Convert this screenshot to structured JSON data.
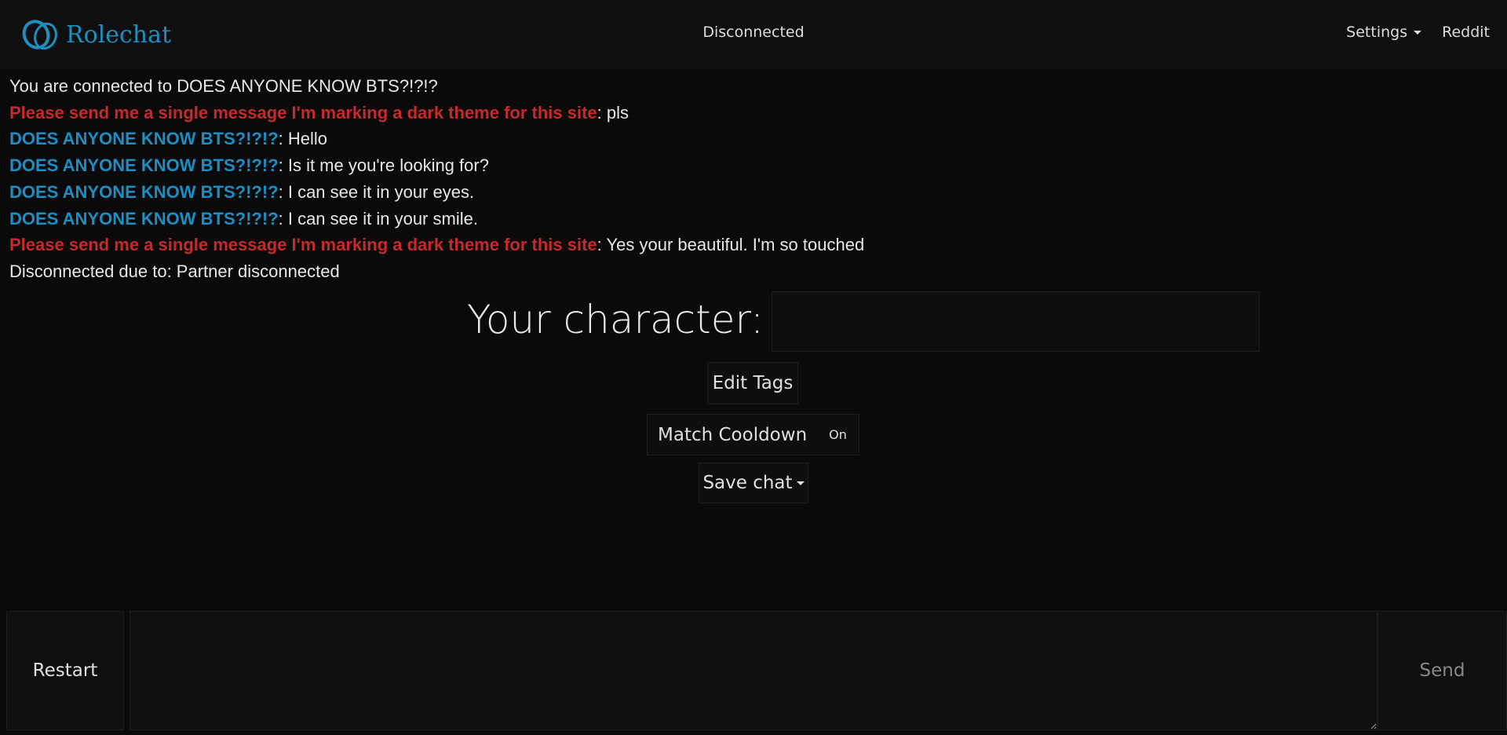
{
  "navbar": {
    "brand": "Rolechat",
    "status": "Disconnected",
    "settings_label": "Settings",
    "reddit_label": "Reddit"
  },
  "colors": {
    "partner": "#1b8ec4",
    "self": "#c42b2b",
    "background": "#0a0a0a"
  },
  "chat": {
    "connected_notice": "You are connected to DOES ANYONE KNOW BTS?!?!?",
    "messages": [
      {
        "author": "Please send me a single message I'm marking a dark theme for this site",
        "role": "self",
        "text": ": pls"
      },
      {
        "author": "DOES ANYONE KNOW BTS?!?!?",
        "role": "partner",
        "text": ": Hello"
      },
      {
        "author": "DOES ANYONE KNOW BTS?!?!?",
        "role": "partner",
        "text": ": Is it me you're looking for?"
      },
      {
        "author": "DOES ANYONE KNOW BTS?!?!?",
        "role": "partner",
        "text": ": I can see it in your eyes."
      },
      {
        "author": "DOES ANYONE KNOW BTS?!?!?",
        "role": "partner",
        "text": ": I can see it in your smile."
      },
      {
        "author": "Please send me a single message I'm marking a dark theme for this site",
        "role": "self",
        "text": ": Yes your beautiful. I'm so touched"
      }
    ],
    "disconnect_notice": "Disconnected due to: Partner disconnected"
  },
  "controls": {
    "character_label": "Your character:",
    "character_value": "",
    "edit_tags": "Edit Tags",
    "match_cooldown": "Match Cooldown",
    "match_cooldown_state": "On",
    "save_chat": "Save chat"
  },
  "composer": {
    "restart": "Restart",
    "send": "Send",
    "message_value": ""
  }
}
